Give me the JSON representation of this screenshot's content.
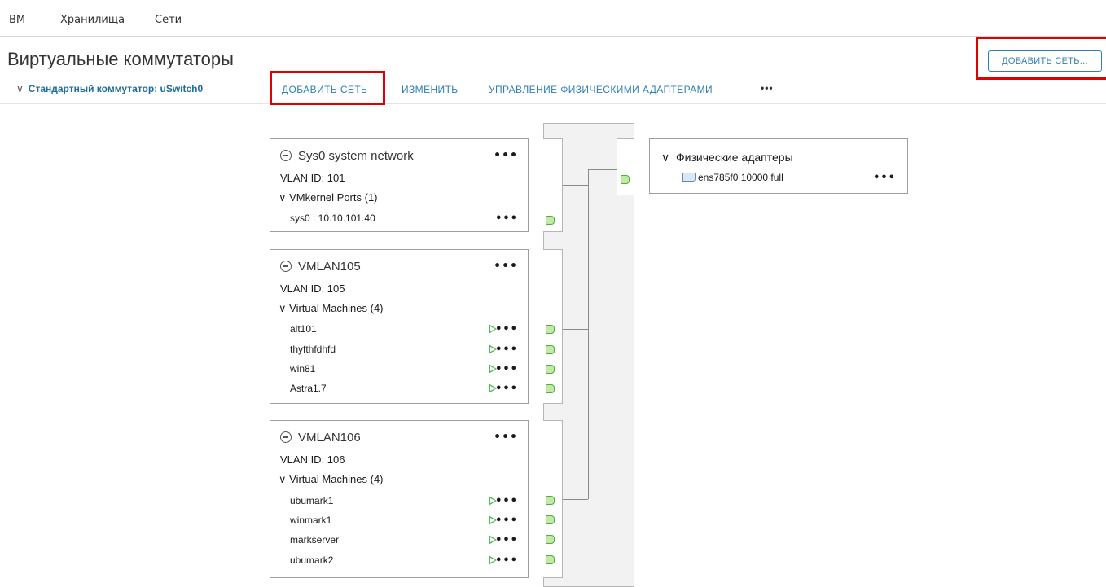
{
  "nav": {
    "tabs": [
      "ВМ",
      "Хранилища",
      "Сети"
    ]
  },
  "page": {
    "title": "Виртуальные коммутаторы",
    "add_network_outline": "ДОБАВИТЬ СЕТЬ..."
  },
  "switch": {
    "name": "Стандартный коммутатор: uSwitch0",
    "actions": {
      "add_network": "ДОБАВИТЬ СЕТЬ",
      "edit": "ИЗМЕНИТЬ",
      "manage_adapters": "УПРАВЛЕНИЕ ФИЗИЧЕСКИМИ АДАПТЕРАМИ",
      "more": "•••"
    }
  },
  "portgroups": [
    {
      "name": "Sys0 system network",
      "vlan": "VLAN ID: 101",
      "section": "VMkernel Ports (1)",
      "items": [
        "sys0 : 10.10.101.40"
      ]
    },
    {
      "name": "VMLAN105",
      "vlan": "VLAN ID: 105",
      "section": "Virtual Machines (4)",
      "items": [
        "alt101",
        "thyfthfdhfd",
        "win81",
        "Astra1.7"
      ]
    },
    {
      "name": "VMLAN106",
      "vlan": "VLAN ID: 106",
      "section": "Virtual Machines (4)",
      "items": [
        "ubumark1",
        "winmark1",
        "markserver",
        "ubumark2"
      ]
    }
  ],
  "physical": {
    "title": "Физические адаптеры",
    "adapter": "ens785f0 10000 full"
  },
  "icons": {
    "dots": "•••",
    "chevron": "∨",
    "chevron_right": "›"
  },
  "colors": {
    "accent": "#2f7fb5",
    "highlight": "#e00000",
    "port_green": "#4fae3a"
  }
}
